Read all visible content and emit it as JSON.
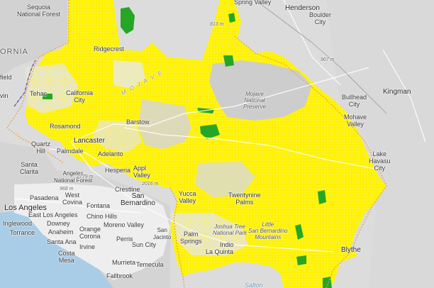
{
  "map": {
    "labels": {
      "springs_partial": "Spring Valley",
      "henderson": "Henderson",
      "boulder_city": "Boulder\nCity",
      "sequoia": "Sequoia\nNational Forest",
      "ornia": "ORNIA",
      "field": "field",
      "vin": "vin",
      "tehachapi": "Tehac",
      "california_city": "California\nCity",
      "ridgecrest": "Ridgecrest",
      "mojave_region": "M O J A V E",
      "rosamond": "Rosamond",
      "lancaster": "Lancaster",
      "barstow": "Barstow",
      "mojave_preserve": "Mojave\nNational\nPreserve",
      "bullhead": "Bullhead\nCity",
      "kingman": "Kingman",
      "mohave_valley": "Mohave\nValley",
      "quartz_hill": "Quartz\nHill",
      "palmdale": "Palmdale",
      "adelanto": "Adelanto",
      "santa_clarita": "Santa\nClarita",
      "angeles_nf": "Angeles\nNational Forest",
      "hesperia": "Hesperia",
      "apple_valley": "Appl\nValley",
      "lake_havasu": "Lake\nHavasu\nCity",
      "pasadena": "Pasadena",
      "west_covina": "West\nCovina",
      "crestline": "Crestline",
      "san_bernardino": "San\nBernardino",
      "yucca_valley": "Yucca\nValley",
      "twentynine_palms": "Twentynine\nPalms",
      "los_angeles": "Los Angeles",
      "east_la": "East Los Angeles",
      "fontana": "Fontana",
      "inglewood": "Inglewood",
      "downey": "Downey",
      "chino_hills": "Chino Hills",
      "moreno_valley": "Moreno Valley",
      "torrance": "Torrance",
      "anaheim": "Anaheim",
      "orange": "Orange",
      "corona": "Corona",
      "perris": "Perris",
      "joshua_tree": "Joshua Tree\nNational Park",
      "little_sb": "Little\nSan Bernardino\nMountains",
      "san_jacinto": "San\nJacinto",
      "palm_springs": "Palm\nSprings",
      "indio": "Indio",
      "la_quinta": "La Quinta",
      "santa_ana": "Santa Ana",
      "irvine": "Irvine",
      "sun_city": "Sun City",
      "costa_mesa": "Costa\nMesa",
      "murrieta": "Murrieta",
      "temecula": "Temecula",
      "blythe": "Blythe",
      "fallbrook": "Fallbrook",
      "salton": "Salton",
      "elev_967": "967 m",
      "elev_813": "813 m",
      "elev_2779": "2779 m",
      "elev_2016": "2016 m",
      "elev_968": "968 m"
    },
    "colors": {
      "base": "#dcdcdc",
      "hillshade": "#cfcfcf",
      "ocean": "#a9cde6",
      "urban": "#f2f2f2",
      "yellow": "#fff200",
      "green": "#26a626",
      "boundary": "#e8a040",
      "county": "#6b4ea0",
      "road": "#ffffff"
    }
  }
}
